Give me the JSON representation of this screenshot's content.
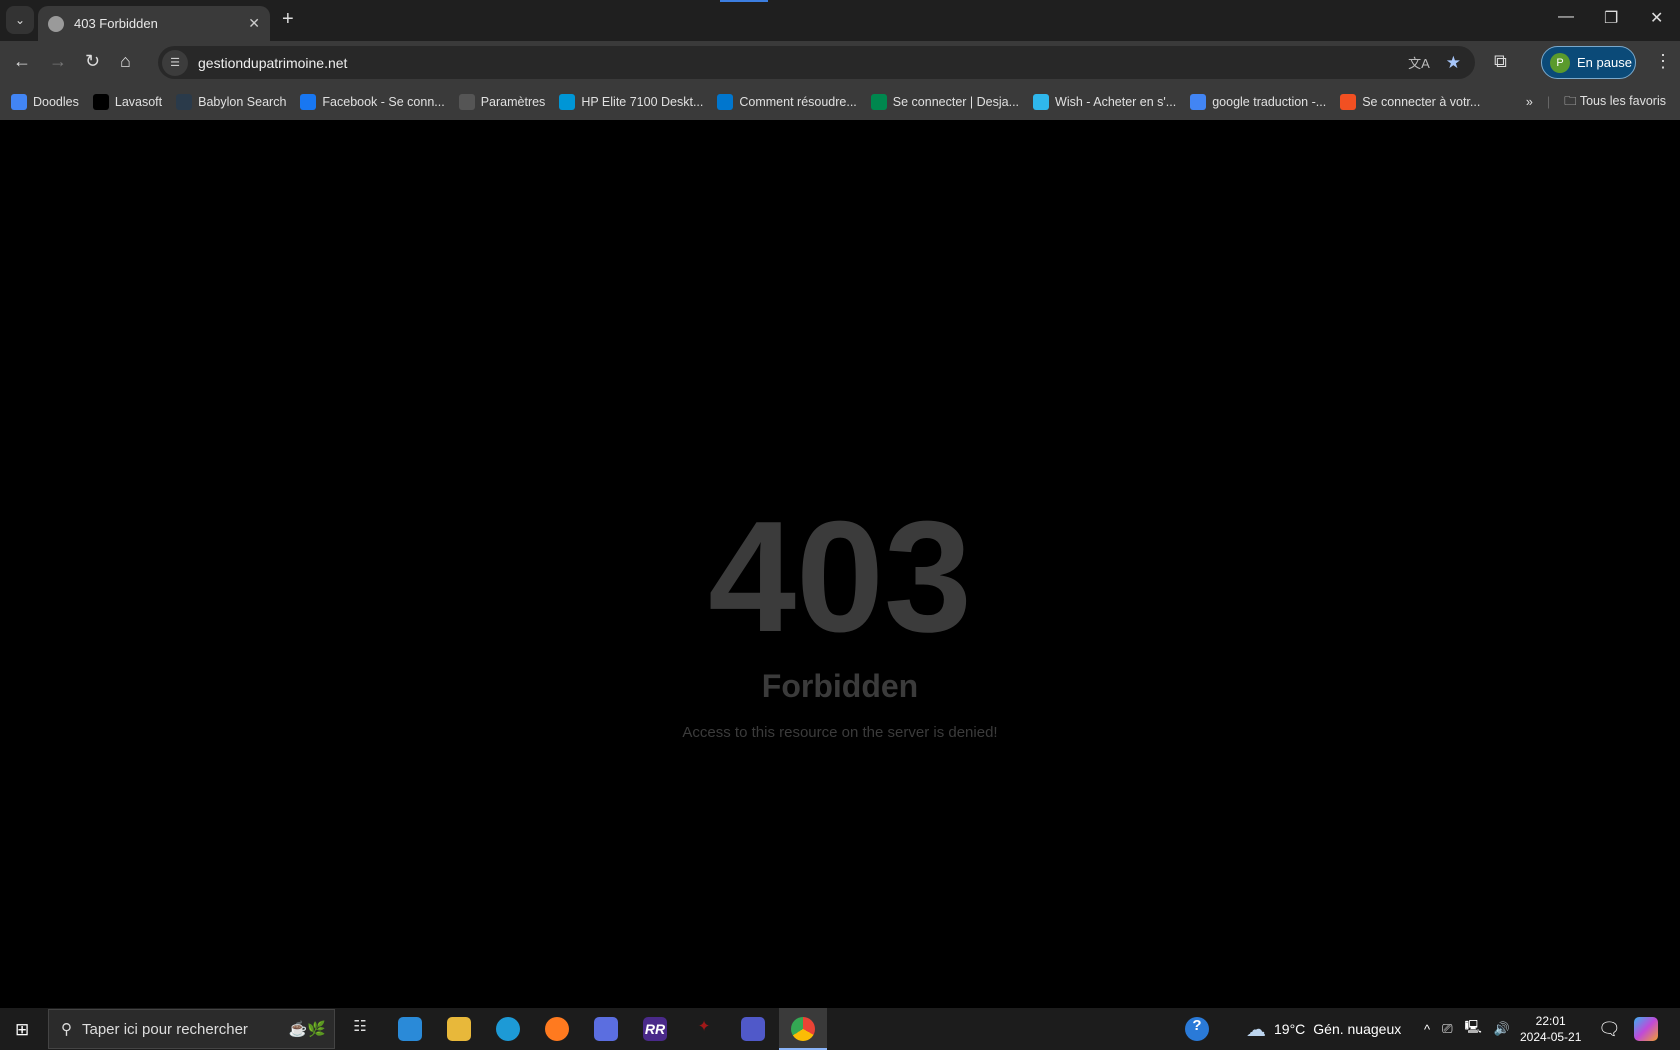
{
  "browser": {
    "tab_title": "403 Forbidden",
    "url": "gestiondupatrimoine.net",
    "profile_initial": "P",
    "profile_status": "En pause",
    "bookmarks": [
      {
        "label": "Doodles",
        "icon": "google-icon",
        "color": "#4285f4"
      },
      {
        "label": "Lavasoft",
        "icon": "lavasoft-icon",
        "color": "#000000"
      },
      {
        "label": "Babylon Search",
        "icon": "babylon-icon",
        "color": "#2a3a4a"
      },
      {
        "label": "Facebook - Se conn...",
        "icon": "facebook-icon",
        "color": "#1877f2"
      },
      {
        "label": "Paramètres",
        "icon": "gear-icon",
        "color": "#555555"
      },
      {
        "label": "HP Elite 7100 Deskt...",
        "icon": "hp-icon",
        "color": "#0096d6"
      },
      {
        "label": "Comment résoudre...",
        "icon": "dell-icon",
        "color": "#0076ce"
      },
      {
        "label": "Se connecter | Desja...",
        "icon": "desjardins-icon",
        "color": "#00874e"
      },
      {
        "label": "Wish - Acheter en s'...",
        "icon": "wish-icon",
        "color": "#2fb7ec"
      },
      {
        "label": "google traduction -...",
        "icon": "google-icon",
        "color": "#4285f4"
      },
      {
        "label": "Se connecter à votr...",
        "icon": "microsoft-icon",
        "color": "#f25022"
      }
    ],
    "all_bookmarks": "Tous les favoris"
  },
  "page": {
    "code": "403",
    "title": "Forbidden",
    "message": "Access to this resource on the server is denied!"
  },
  "taskbar": {
    "search_placeholder": "Taper ici pour rechercher",
    "temperature": "19°C",
    "weather": "Gén. nuageux",
    "time": "22:01",
    "date": "2024-05-21"
  }
}
